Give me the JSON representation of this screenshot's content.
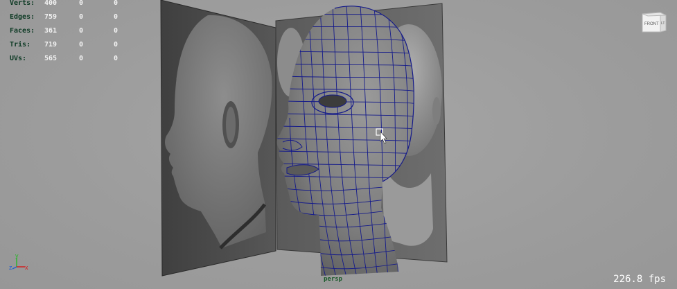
{
  "hud": {
    "rows": [
      {
        "label": "Verts:",
        "v1": "400",
        "v2": "0",
        "v3": "0"
      },
      {
        "label": "Edges:",
        "v1": "759",
        "v2": "0",
        "v3": "0"
      },
      {
        "label": "Faces:",
        "v1": "361",
        "v2": "0",
        "v3": "0"
      },
      {
        "label": "Tris:",
        "v1": "719",
        "v2": "0",
        "v3": "0"
      },
      {
        "label": "UVs:",
        "v1": "565",
        "v2": "0",
        "v3": "0"
      }
    ]
  },
  "viewcube": {
    "front_label": "FRONT",
    "side_label": "LT"
  },
  "camera": {
    "name": "persp"
  },
  "fps": "226.8 fps",
  "axis": {
    "y": "y",
    "z": "z",
    "x": "x"
  },
  "colors": {
    "wire": "#141a8a",
    "mesh": "#7b7b7b",
    "plate": "#4a4a4a",
    "background": "#9d9d9d",
    "hud_label": "#0d3a24"
  },
  "icons": {
    "cursor": "select-cursor-icon",
    "viewcube": "viewcube-icon",
    "axis": "axis-gizmo-icon"
  }
}
